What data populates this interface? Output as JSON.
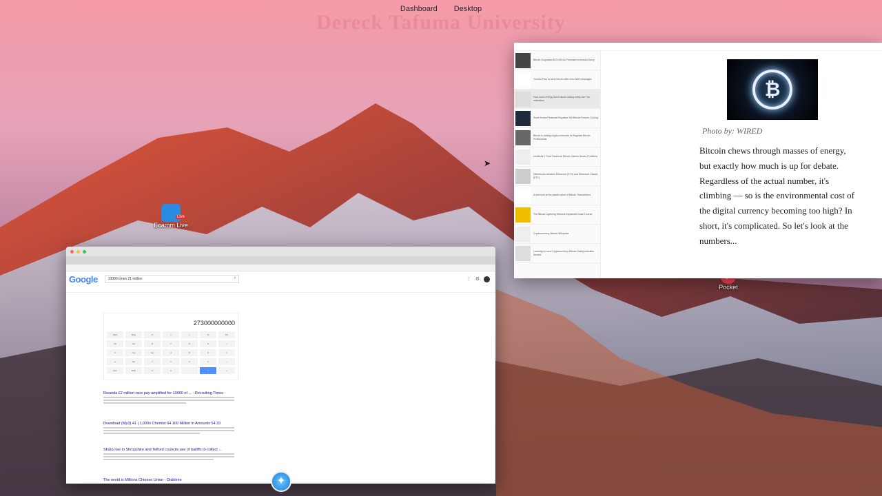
{
  "menubar": {
    "items": [
      "Dashboard",
      "Desktop"
    ]
  },
  "watermark": "Dereck Tafuma University",
  "desktop_icons": {
    "ecamm": {
      "label": "Ecamm Live",
      "badge": "Live"
    },
    "pocket": {
      "label": "Pocket"
    }
  },
  "browser": {
    "google_logo": "Google",
    "search_query": "13000 times 21 million",
    "calculator_display": "273000000000",
    "calc_keys": [
      "Rad",
      "Deg",
      "x!",
      "(",
      ")",
      "%",
      "AC",
      "Inv",
      "sin",
      "ln",
      "7",
      "8",
      "9",
      "÷",
      "π",
      "cos",
      "log",
      "4",
      "5",
      "6",
      "×",
      "e",
      "tan",
      "√",
      "1",
      "2",
      "3",
      "−",
      "Ans",
      "EXP",
      "xʸ",
      "0",
      ".",
      "=",
      "+"
    ],
    "results": [
      {
        "title": "Rwanda £2 million race pay amplified for 13000 of ... - Recruiting Times"
      },
      {
        "title": "Download (Mp3) 41 | 1,000x Chemist 64 100 Million in Amounts 54.33"
      },
      {
        "title": "Sharp rise in Shropshire and Telford councils use of bailiffs to collect ..."
      },
      {
        "title": "The world is Millions Chinese Union - Diablerie"
      }
    ]
  },
  "reader": {
    "caption": "Photo by: WIRED",
    "body": "Bitcoin chews through masses of energy, but exactly how much is up for debate. Regardless of the actual number, it's climbing — so is the environmental cost of the digital currency becoming too high? In short, it's complicated. So let's look at the numbers...",
    "btc_symbol": "₿",
    "list_items": [
      "Bitcoin Surpasses $13,000 As Prominent Investors Decry",
      "Toronto Files to send bitcoin after loss 2000 messages",
      "How much energy does bitcoin mining really use? An estimation",
      "South Korea Financial Regulator Set Bitcoin Futures Closing",
      "Bitcoin is adding cryptocurrencies to Regulate Bitcoin Professional",
      "Unofficial 1 Final Facebook Bitcoin Games Money Problems",
      "Differences between Ethereum (ETH) and Ethereum Classic (ETC)",
      "A new look at the plastic value of Bitcoin Transactions",
      "The Bitcoin Lightning Network Explained Crash Course",
      "Cryptocurrency Bitcoin Wikipedia",
      "Learning to Lend Cryptocurrency Bitcoin Safety Activities Around"
    ]
  },
  "dock": {
    "safari_icon": "compass-icon"
  }
}
